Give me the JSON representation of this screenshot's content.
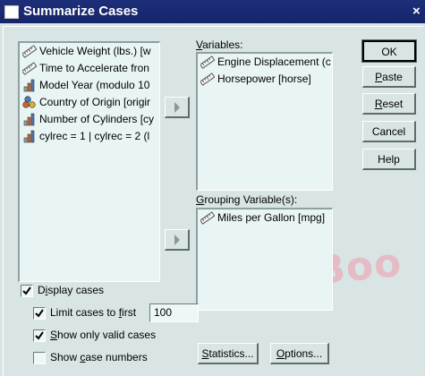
{
  "window": {
    "title": "Summarize Cases",
    "close_glyph": "×"
  },
  "source_list": {
    "items": [
      {
        "label": "Vehicle Weight (lbs.) [w",
        "icon": "ruler-icon"
      },
      {
        "label": "Time to Accelerate fron",
        "icon": "ruler-icon"
      },
      {
        "label": "Model Year (modulo 10",
        "icon": "bar-chart-icon"
      },
      {
        "label": "Country of Origin [origir",
        "icon": "nominal-icon"
      },
      {
        "label": "Number of Cylinders [cy",
        "icon": "bar-chart-icon"
      },
      {
        "label": "cylrec = 1 | cylrec = 2 (l",
        "icon": "bar-chart-icon"
      }
    ]
  },
  "variables": {
    "label_pre": "",
    "label_u": "V",
    "label_post": "ariables:",
    "items": [
      {
        "label": "Engine Displacement (c",
        "icon": "ruler-icon"
      },
      {
        "label": "Horsepower [horse]",
        "icon": "ruler-icon"
      }
    ]
  },
  "grouping": {
    "label_pre": "",
    "label_u": "G",
    "label_post": "rouping Variable(s):",
    "items": [
      {
        "label": "Miles per Gallon [mpg]",
        "icon": "ruler-icon"
      }
    ]
  },
  "buttons": {
    "ok": "OK",
    "paste_u": "P",
    "paste_rest": "aste",
    "reset_u": "R",
    "reset_rest": "eset",
    "cancel": "Cancel",
    "help": "Help",
    "statistics_u": "S",
    "statistics_rest": "tatistics...",
    "options_u": "O",
    "options_rest": "ptions..."
  },
  "options": {
    "display_cases_pre": "D",
    "display_cases_u": "i",
    "display_cases_post": "splay cases",
    "display_cases_checked": true,
    "limit_cases_pre": "Limit cases to ",
    "limit_cases_u": "f",
    "limit_cases_post": "irst",
    "limit_cases_checked": true,
    "limit_value": "100",
    "valid_pre": "",
    "valid_u": "S",
    "valid_post": "how only valid cases",
    "valid_checked": true,
    "numbers_pre": "Show ",
    "numbers_u": "c",
    "numbers_post": "ase numbers",
    "numbers_checked": false
  },
  "watermark": "DropBoo"
}
